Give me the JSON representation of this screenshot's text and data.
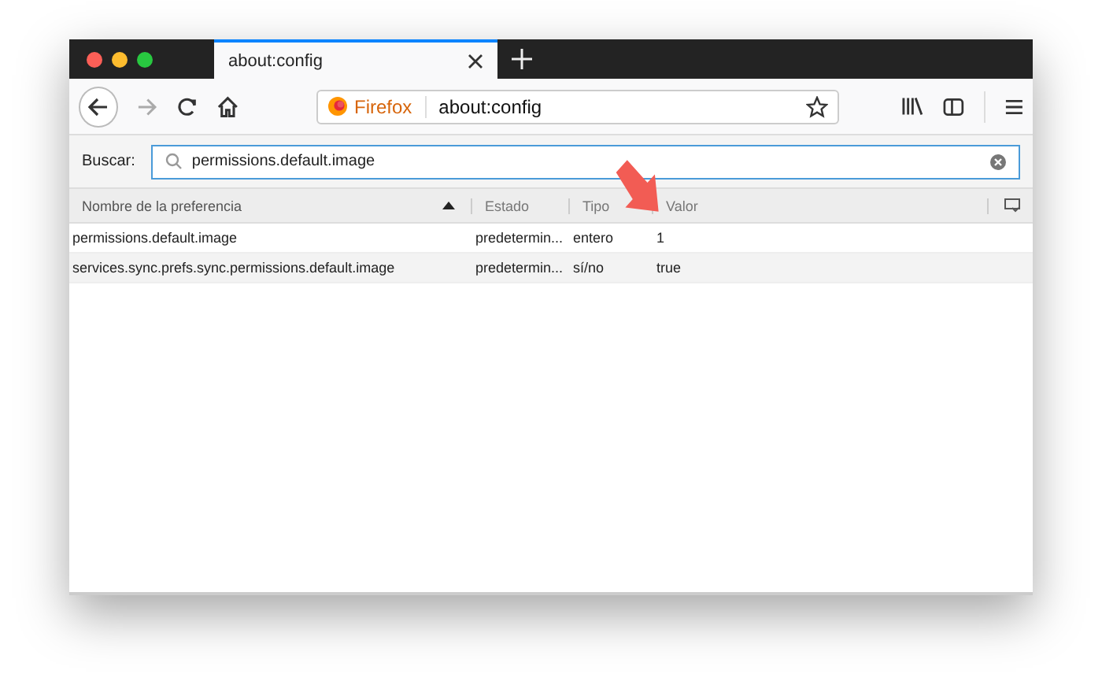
{
  "tab": {
    "title": "about:config",
    "selected": true
  },
  "address_bar": {
    "brand": "Firefox",
    "url": "about:config"
  },
  "search": {
    "label": "Buscar:",
    "value": "permissions.default.image"
  },
  "table": {
    "columns": [
      {
        "label": "Nombre de la preferencia",
        "sorted": true
      },
      {
        "label": "Estado",
        "sorted": false
      },
      {
        "label": "Tipo",
        "sorted": false
      },
      {
        "label": "Valor",
        "sorted": false
      }
    ],
    "rows": [
      {
        "cells": [
          "permissions.default.image",
          "predetermin...",
          "entero",
          "1"
        ]
      },
      {
        "cells": [
          "services.sync.prefs.sync.permissions.default.image",
          "predetermin...",
          "sí/no",
          "true"
        ]
      }
    ]
  }
}
